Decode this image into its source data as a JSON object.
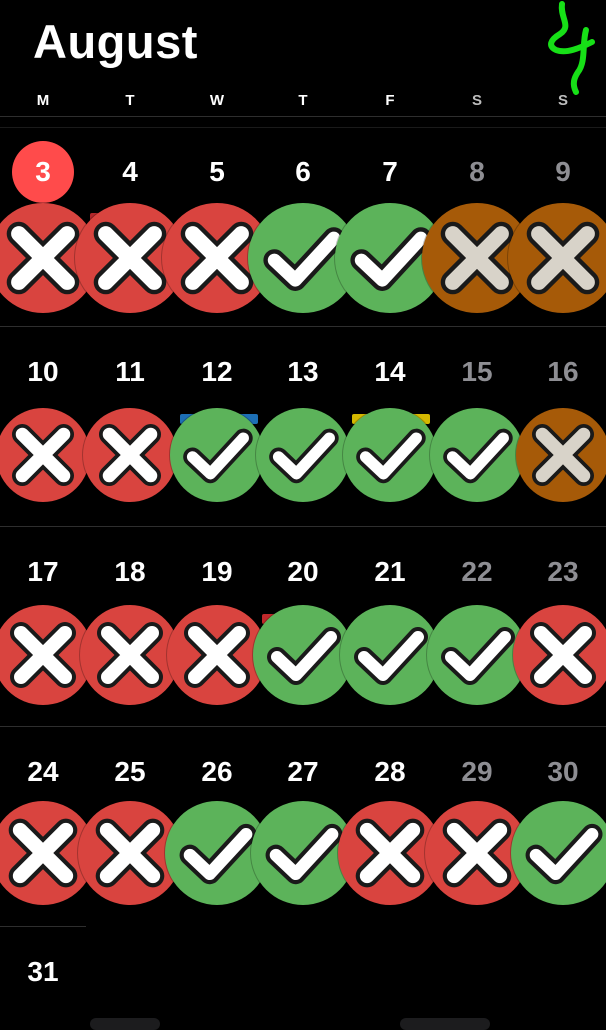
{
  "header": {
    "month": "August"
  },
  "weekdays": [
    "M",
    "T",
    "W",
    "T",
    "F",
    "S",
    "S"
  ],
  "colors": {
    "miss": "#d9443f",
    "done": "#5cb35a",
    "skip": "#a65a08",
    "today": "#ff4b4b",
    "doodle": "#17e017"
  },
  "today": "3",
  "weeks": [
    {
      "days": [
        {
          "num": "3",
          "status": "miss"
        },
        {
          "num": "4",
          "status": "miss"
        },
        {
          "num": "5",
          "status": "miss"
        },
        {
          "num": "6",
          "status": "done"
        },
        {
          "num": "7",
          "status": "done"
        },
        {
          "num": "8",
          "status": "skip"
        },
        {
          "num": "9",
          "status": "skip"
        }
      ]
    },
    {
      "days": [
        {
          "num": "10",
          "status": "miss"
        },
        {
          "num": "11",
          "status": "miss"
        },
        {
          "num": "12",
          "status": "done"
        },
        {
          "num": "13",
          "status": "done"
        },
        {
          "num": "14",
          "status": "done"
        },
        {
          "num": "15",
          "status": "done"
        },
        {
          "num": "16",
          "status": "skip"
        }
      ]
    },
    {
      "days": [
        {
          "num": "17",
          "status": "miss"
        },
        {
          "num": "18",
          "status": "miss"
        },
        {
          "num": "19",
          "status": "miss"
        },
        {
          "num": "20",
          "status": "done"
        },
        {
          "num": "21",
          "status": "done"
        },
        {
          "num": "22",
          "status": "done"
        },
        {
          "num": "23",
          "status": "miss"
        }
      ]
    },
    {
      "days": [
        {
          "num": "24",
          "status": "miss"
        },
        {
          "num": "25",
          "status": "miss"
        },
        {
          "num": "26",
          "status": "done"
        },
        {
          "num": "27",
          "status": "done"
        },
        {
          "num": "28",
          "status": "miss"
        },
        {
          "num": "29",
          "status": "miss"
        },
        {
          "num": "30",
          "status": "done"
        }
      ]
    },
    {
      "days": [
        {
          "num": "31",
          "status": ""
        }
      ]
    }
  ],
  "icons": {
    "miss": "x-icon",
    "skip": "x-icon",
    "done": "check-icon"
  }
}
